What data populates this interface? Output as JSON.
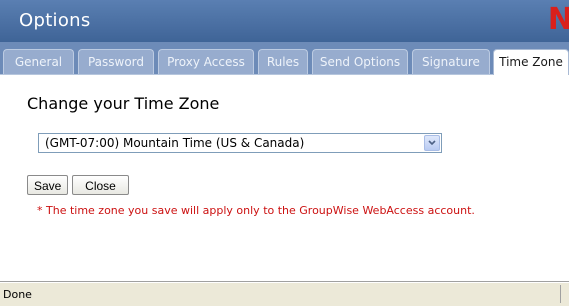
{
  "window": {
    "title": "Options",
    "logo_letter": "N"
  },
  "tabs": [
    {
      "label": "General"
    },
    {
      "label": "Password"
    },
    {
      "label": "Proxy Access"
    },
    {
      "label": "Rules"
    },
    {
      "label": "Send Options"
    },
    {
      "label": "Signature"
    },
    {
      "label": "Time Zone",
      "active": true
    }
  ],
  "main": {
    "heading": "Change your Time Zone",
    "timezone_select": {
      "selected": "(GMT-07:00) Mountain Time (US & Canada)"
    },
    "save_label": "Save",
    "close_label": "Close",
    "note": "* The time zone you save will apply only to the GroupWise WebAccess account."
  },
  "statusbar": {
    "text": "Done"
  },
  "colors": {
    "title_bar": "#4a6fa5",
    "tab_strip": "#6d8bb8",
    "note_text": "#cc1111",
    "logo": "#d9201c"
  },
  "icons": {
    "dropdown": "chevron-down-icon"
  }
}
